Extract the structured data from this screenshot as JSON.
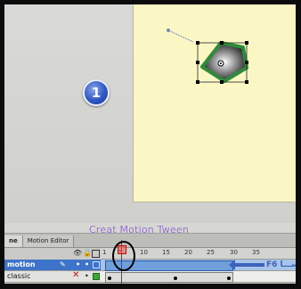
{
  "panel": {
    "tabs": [
      {
        "label": "ne",
        "active": true
      },
      {
        "label": "Motion Editor",
        "active": false
      }
    ]
  },
  "timeline": {
    "ruler_ticks": [
      "1",
      "5",
      "10",
      "15",
      "20",
      "25",
      "30",
      "35"
    ],
    "layers": [
      {
        "name": "motion",
        "icons": [
          "pencil-icon",
          "eye-dot",
          "lock-dot",
          "outline-square"
        ],
        "outline_color": "#3d73c8"
      },
      {
        "name": "classic",
        "icons": [
          "delete-x-icon",
          "lock-dot",
          "outline-square"
        ],
        "outline_color": "#3aa83a"
      }
    ],
    "playhead_frame": 4
  },
  "annotations": {
    "title": "Creat Motion Tween",
    "step_number": "1",
    "shortcut_label": "F6 ســـا"
  },
  "colors": {
    "stage": "#fbf7c4",
    "work_area": "#d6d6d2",
    "shape_fill_edge": "#2e8b3a",
    "annotation_purple": "#8e67c8",
    "annotation_blue": "#3e63b8",
    "playhead": "#e01010"
  }
}
